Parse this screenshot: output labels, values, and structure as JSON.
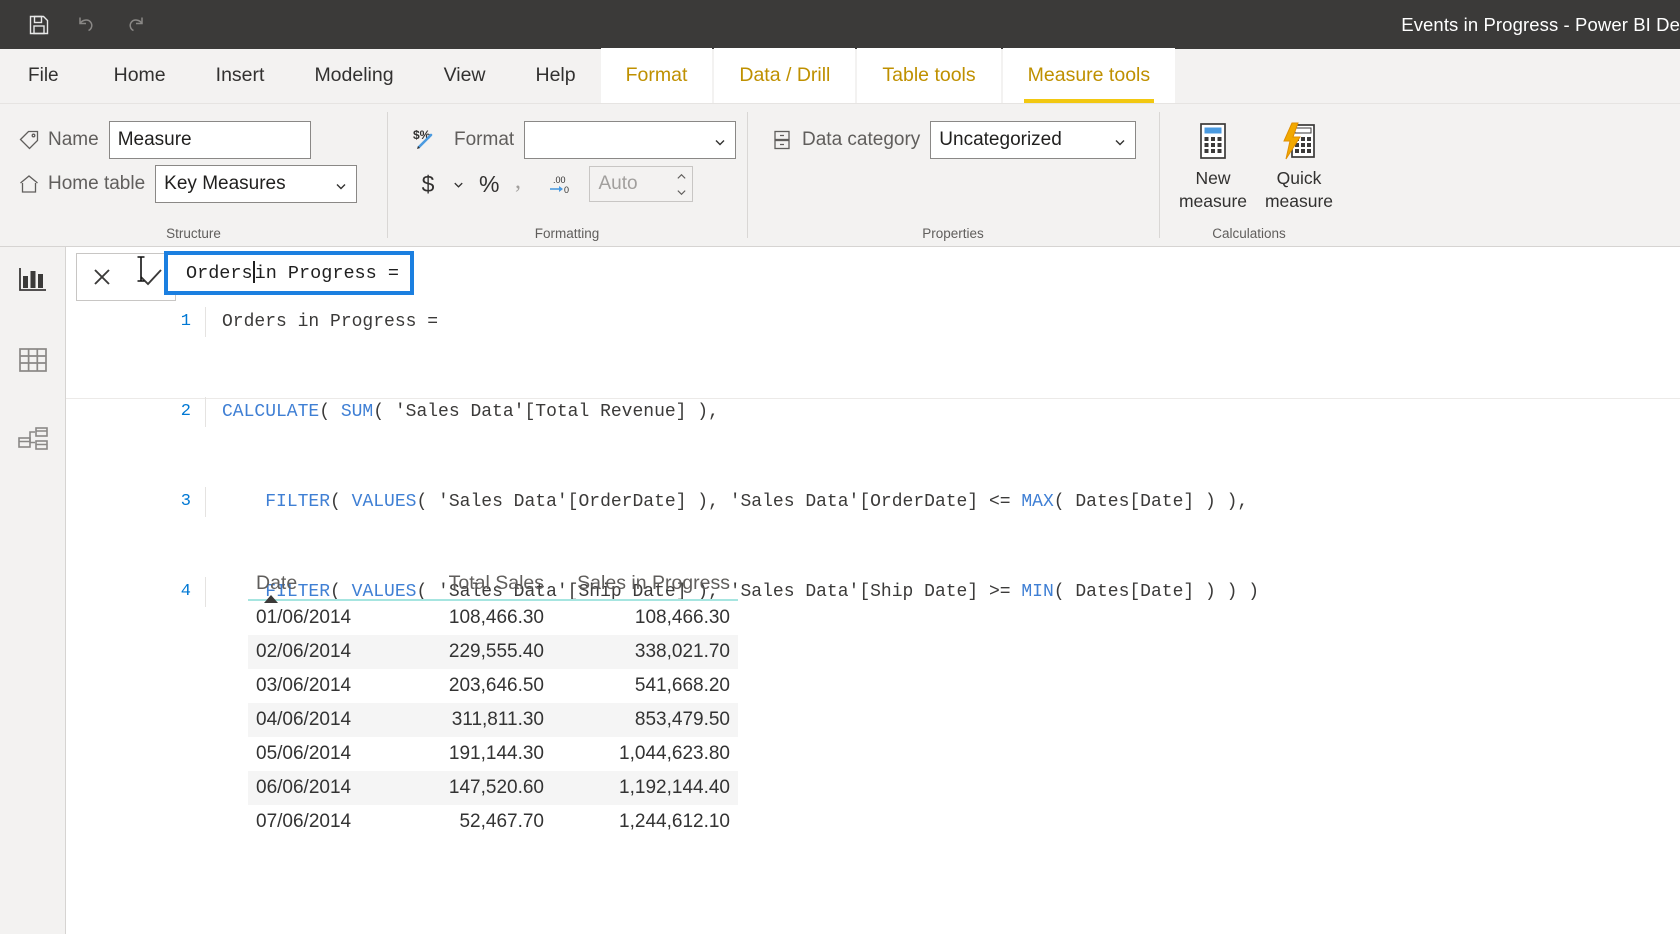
{
  "window": {
    "title": "Events in Progress - Power BI De",
    "quick_access": [
      {
        "name": "save-icon",
        "label": "Save"
      },
      {
        "name": "undo-icon",
        "label": "Undo"
      },
      {
        "name": "redo-icon",
        "label": "Redo"
      }
    ]
  },
  "ribbon": {
    "tabs": [
      {
        "label": "File",
        "type": "file",
        "active": false
      },
      {
        "label": "Home",
        "type": "standard",
        "active": false
      },
      {
        "label": "Insert",
        "type": "standard",
        "active": false
      },
      {
        "label": "Modeling",
        "type": "standard",
        "active": false
      },
      {
        "label": "View",
        "type": "standard",
        "active": false
      },
      {
        "label": "Help",
        "type": "standard",
        "active": false
      },
      {
        "label": "Format",
        "type": "contextual",
        "active": false
      },
      {
        "label": "Data / Drill",
        "type": "contextual",
        "active": false
      },
      {
        "label": "Table tools",
        "type": "contextual",
        "active": false
      },
      {
        "label": "Measure tools",
        "type": "contextual",
        "active": true
      }
    ],
    "groups": {
      "structure": {
        "label": "Structure",
        "name_label": "Name",
        "name_value": "Measure",
        "home_table_label": "Home table",
        "home_table_value": "Key Measures"
      },
      "formatting": {
        "label": "Formatting",
        "format_label": "Format",
        "format_value": "",
        "currency_button": "$",
        "percent_button": "%",
        "thousands_button": ",",
        "decimals_button": ".00",
        "decimals_value": "",
        "decimals_placeholder": "Auto"
      },
      "properties": {
        "label": "Properties",
        "data_category_label": "Data category",
        "data_category_value": "Uncategorized"
      },
      "calculations": {
        "label": "Calculations",
        "buttons": [
          {
            "line1": "New",
            "line2": "measure",
            "icon": "calculator-icon"
          },
          {
            "line1": "Quick",
            "line2": "measure",
            "icon": "lightning-calculator-icon"
          }
        ]
      }
    }
  },
  "navrail": {
    "items": [
      {
        "name": "report-view",
        "icon": "bar-chart-icon",
        "active": true
      },
      {
        "name": "data-view",
        "icon": "table-grid-icon",
        "active": false
      },
      {
        "name": "model-view",
        "icon": "relationships-icon",
        "active": false
      }
    ]
  },
  "formula_bar": {
    "cancel_label": "✕",
    "commit_label": "✓",
    "name_editor": {
      "text_before_caret": "Orders",
      "text_after_caret": " in Progress =",
      "focused": true
    },
    "lines": [
      {
        "num": "1",
        "segments": [
          {
            "text": "Orders in Progress =",
            "type": "plain"
          }
        ]
      },
      {
        "num": "2",
        "segments": [
          {
            "text": "CALCULATE",
            "type": "fn"
          },
          {
            "text": "( ",
            "type": "plain"
          },
          {
            "text": "SUM",
            "type": "fn"
          },
          {
            "text": "( 'Sales Data'[Total Revenue] ),",
            "type": "plain"
          }
        ]
      },
      {
        "num": "3",
        "segments": [
          {
            "text": "    ",
            "type": "plain"
          },
          {
            "text": "FILTER",
            "type": "fn"
          },
          {
            "text": "( ",
            "type": "plain"
          },
          {
            "text": "VALUES",
            "type": "fn"
          },
          {
            "text": "( 'Sales Data'[OrderDate] ), 'Sales Data'[OrderDate] <= ",
            "type": "plain"
          },
          {
            "text": "MAX",
            "type": "fn"
          },
          {
            "text": "( Dates[Date] ) ),",
            "type": "plain"
          }
        ]
      },
      {
        "num": "4",
        "segments": [
          {
            "text": "    ",
            "type": "plain"
          },
          {
            "text": "FILTER",
            "type": "fn"
          },
          {
            "text": "( ",
            "type": "plain"
          },
          {
            "text": "VALUES",
            "type": "fn"
          },
          {
            "text": "( 'Sales Data'[Ship Date] ), 'Sales Data'[Ship Date] >= ",
            "type": "plain"
          },
          {
            "text": "MIN",
            "type": "fn"
          },
          {
            "text": "( Dates[Date] ) ) )",
            "type": "plain"
          }
        ]
      }
    ]
  },
  "table_visual": {
    "columns": [
      "Date",
      "Total Sales",
      "Sales in Progress"
    ],
    "sort_column": "Date",
    "sort_direction": "ascending",
    "rows": [
      {
        "date": "01/06/2014",
        "total_sales": "108,466.30",
        "sales_in_progress": "108,466.30"
      },
      {
        "date": "02/06/2014",
        "total_sales": "229,555.40",
        "sales_in_progress": "338,021.70"
      },
      {
        "date": "03/06/2014",
        "total_sales": "203,646.50",
        "sales_in_progress": "541,668.20"
      },
      {
        "date": "04/06/2014",
        "total_sales": "311,811.30",
        "sales_in_progress": "853,479.50"
      },
      {
        "date": "05/06/2014",
        "total_sales": "191,144.30",
        "sales_in_progress": "1,044,623.80"
      },
      {
        "date": "06/06/2014",
        "total_sales": "147,520.60",
        "sales_in_progress": "1,192,144.40"
      },
      {
        "date": "07/06/2014",
        "total_sales": "52,467.70",
        "sales_in_progress": "1,244,612.10"
      }
    ]
  },
  "colors": {
    "titlebar": "#3b3a39",
    "accent_yellow": "#f2c811",
    "contextual_tab_text": "#bf9000",
    "selection_blue": "#1b7fe0",
    "header_underline": "#a6e5e0",
    "code_function": "#3f7fd4"
  }
}
